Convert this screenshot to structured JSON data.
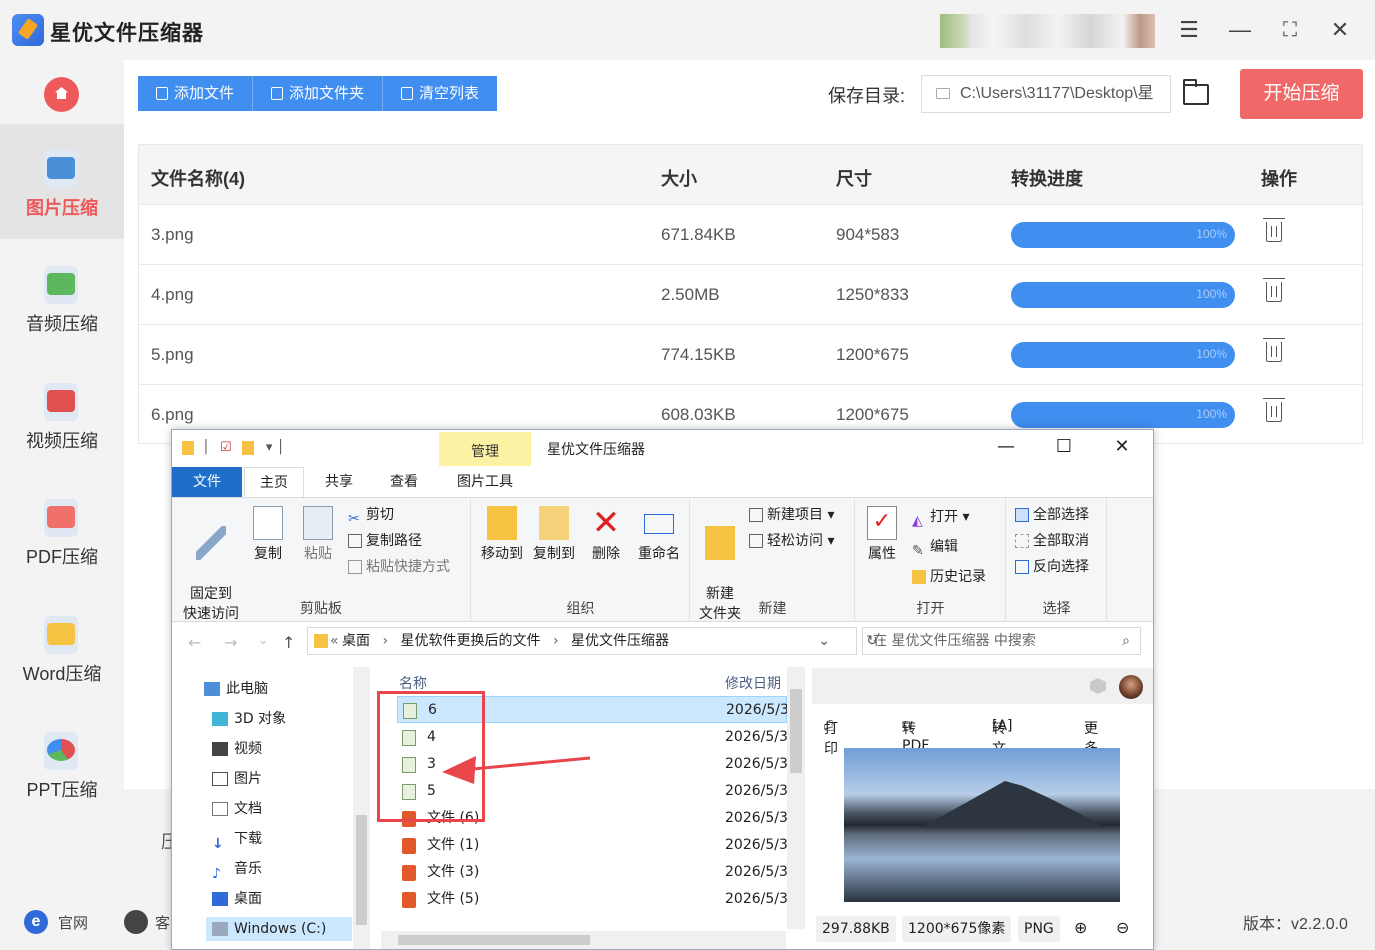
{
  "app": {
    "title": "星优文件压缩器"
  },
  "colors": {
    "accent": "#3f8ef0",
    "danger": "#f16868",
    "active_nav_text": "#ee5a5a"
  },
  "sidebar": {
    "items": [
      {
        "label": "图片压缩",
        "icon": "image-icon",
        "active": true
      },
      {
        "label": "音频压缩",
        "icon": "audio-icon",
        "active": false
      },
      {
        "label": "视频压缩",
        "icon": "video-icon",
        "active": false
      },
      {
        "label": "PDF压缩",
        "icon": "pdf-icon",
        "active": false
      },
      {
        "label": "Word压缩",
        "icon": "word-icon",
        "active": false
      },
      {
        "label": "PPT压缩",
        "icon": "ppt-icon",
        "active": false
      }
    ]
  },
  "toolbar": {
    "add_file": "添加文件",
    "add_folder": "添加文件夹",
    "clear_list": "清空列表"
  },
  "save": {
    "label": "保存目录:",
    "path": "C:\\Users\\31177\\Desktop\\星"
  },
  "start_button": "开始压缩",
  "table": {
    "headers": {
      "name": "文件名称(4)",
      "size": "大小",
      "dimension": "尺寸",
      "progress": "转换进度",
      "action": "操作"
    },
    "rows": [
      {
        "name": "3.png",
        "size": "671.84KB",
        "dimension": "904*583",
        "progress": "100%",
        "progress_value": 1.0
      },
      {
        "name": "4.png",
        "size": "2.50MB",
        "dimension": "1250*833",
        "progress": "100%",
        "progress_value": 1.0
      },
      {
        "name": "5.png",
        "size": "774.15KB",
        "dimension": "1200*675",
        "progress": "100%",
        "progress_value": 1.0
      },
      {
        "name": "6.png",
        "size": "608.03KB",
        "dimension": "1200*675",
        "progress": "100%",
        "progress_value": 1.0
      }
    ]
  },
  "partial_text": "压",
  "footer": {
    "website": "官网",
    "service": "客",
    "version": "版本：v2.2.0.0"
  },
  "explorer": {
    "title": "星优文件压缩器",
    "manage_tab": "管理",
    "tabs": [
      "文件",
      "主页",
      "共享",
      "查看",
      "图片工具"
    ],
    "active_tab": "主页",
    "ribbon": {
      "clipboard": {
        "title": "剪贴板",
        "pin": "固定到\n快速访问",
        "copy": "复制",
        "paste": "粘贴",
        "cut": "剪切",
        "copy_path": "复制路径",
        "paste_shortcut": "粘贴快捷方式"
      },
      "organize": {
        "title": "组织",
        "move_to": "移动到",
        "copy_to": "复制到",
        "delete": "删除",
        "rename": "重命名"
      },
      "new": {
        "title": "新建",
        "new_folder": "新建\n文件夹",
        "new_item": "新建项目",
        "easy_access": "轻松访问"
      },
      "open": {
        "title": "打开",
        "properties": "属性",
        "open": "打开",
        "edit": "编辑",
        "history": "历史记录"
      },
      "select": {
        "title": "选择",
        "select_all": "全部选择",
        "select_none": "全部取消",
        "invert": "反向选择"
      }
    },
    "breadcrumb": [
      "桌面",
      "星优软件更换后的文件",
      "星优文件压缩器"
    ],
    "search_placeholder": "在 星优文件压缩器 中搜索",
    "tree": [
      "此电脑",
      "3D 对象",
      "视频",
      "图片",
      "文档",
      "下载",
      "音乐",
      "桌面",
      "Windows (C:)"
    ],
    "columns": {
      "name": "名称",
      "date": "修改日期"
    },
    "files": [
      {
        "name": "6",
        "date": "2026/5/3",
        "type": "image",
        "selected": true
      },
      {
        "name": "4",
        "date": "2026/5/3",
        "type": "image",
        "selected": false
      },
      {
        "name": "3",
        "date": "2026/5/3",
        "type": "image",
        "selected": false
      },
      {
        "name": "5",
        "date": "2026/5/3",
        "type": "image",
        "selected": false
      },
      {
        "name": "文件 (6)",
        "date": "2026/5/3",
        "type": "ppt",
        "selected": false
      },
      {
        "name": "文件 (1)",
        "date": "2026/5/3",
        "type": "ppt",
        "selected": false
      },
      {
        "name": "文件 (3)",
        "date": "2026/5/3",
        "type": "ppt",
        "selected": false
      },
      {
        "name": "文件 (5)",
        "date": "2026/5/3",
        "type": "ppt",
        "selected": false
      }
    ],
    "preview": {
      "actions": {
        "print": "打印",
        "to_pdf": "转PDF",
        "to_text": "转文字",
        "more": "更多"
      },
      "size": "297.88KB",
      "pixels": "1200*675像素",
      "format": "PNG"
    }
  }
}
